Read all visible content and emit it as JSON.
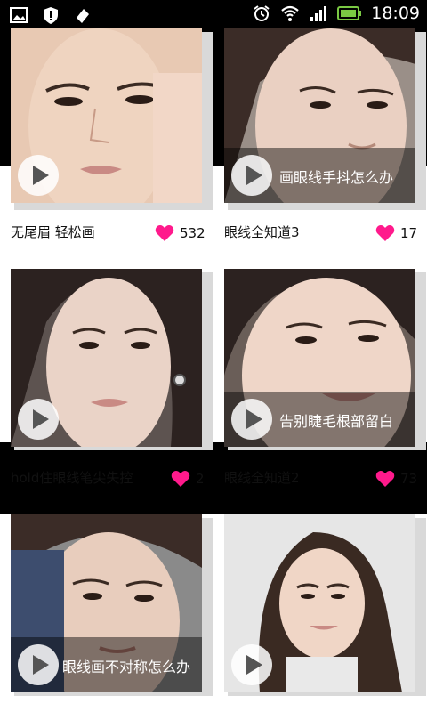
{
  "status_bar": {
    "time": "18:09",
    "icons_left": [
      "image-icon",
      "alert-shield-icon",
      "usb-debug-icon"
    ],
    "icons_right": [
      "alarm-icon",
      "wifi-icon",
      "signal-icon",
      "battery-icon"
    ]
  },
  "colors": {
    "heart": "#ff1a8c",
    "background": "#000000",
    "card_bg": "#ffffff"
  },
  "videos": [
    {
      "title": "无尾眉 轻松画",
      "overlay": "",
      "likes": "532"
    },
    {
      "title": "眼线全知道3",
      "overlay": "画眼线手抖怎么办",
      "likes": "17"
    },
    {
      "title": "hold住眼线笔尖失控",
      "overlay": "",
      "likes": "2"
    },
    {
      "title": "眼线全知道2",
      "overlay": "告别睫毛根部留白",
      "likes": "73"
    },
    {
      "title": "",
      "overlay": "眼线画不对称怎么办",
      "likes": ""
    },
    {
      "title": "",
      "overlay": "",
      "likes": ""
    }
  ]
}
